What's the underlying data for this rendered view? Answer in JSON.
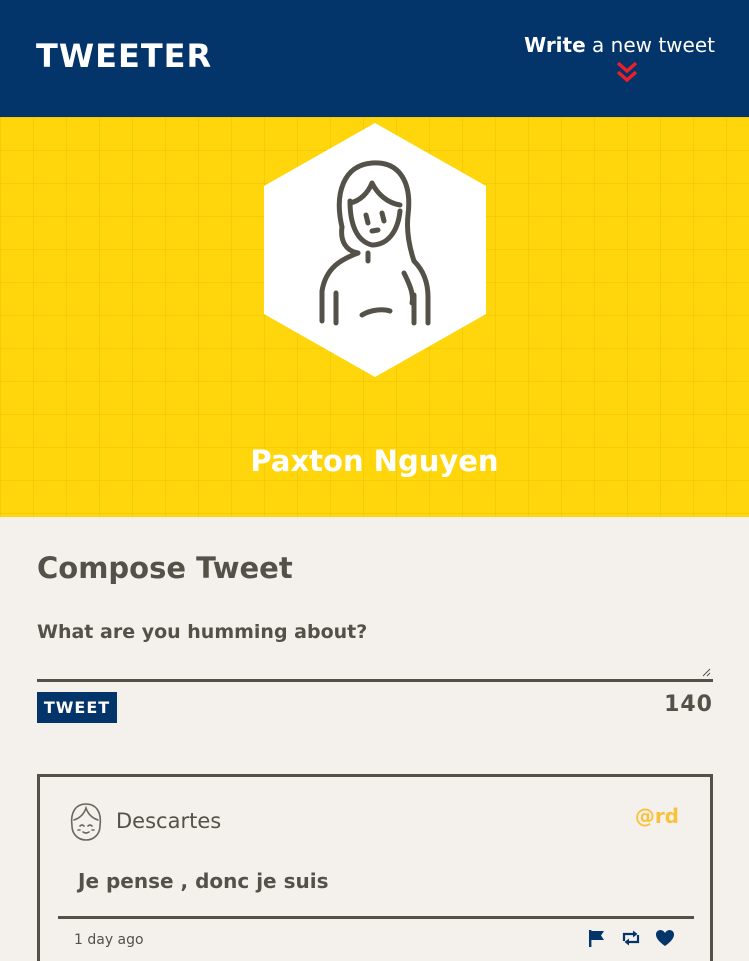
{
  "nav": {
    "brand": "TWEETER",
    "write_bold": "Write",
    "write_rest": " a new tweet",
    "chevron_icon": "double-chevron-down-icon",
    "colors": {
      "background": "#03346a",
      "chevron": "#e8202a"
    }
  },
  "profile": {
    "name": "Paxton Nguyen",
    "avatar_icon": "user-avatar-icon",
    "colors": {
      "banner": "#fed60b"
    }
  },
  "compose": {
    "title": "Compose Tweet",
    "placeholder": "What are you humming about?",
    "button_label": "TWEET",
    "counter": "140"
  },
  "tweets": [
    {
      "author": "Descartes",
      "handle": "@rd",
      "content": "Je pense , donc je suis",
      "time_ago": "1 day ago",
      "icons": [
        "flag-icon",
        "retweet-icon",
        "heart-icon"
      ]
    }
  ],
  "colors": {
    "page": "#f4f1ec",
    "text": "#545149",
    "handle": "#f9c23c"
  }
}
